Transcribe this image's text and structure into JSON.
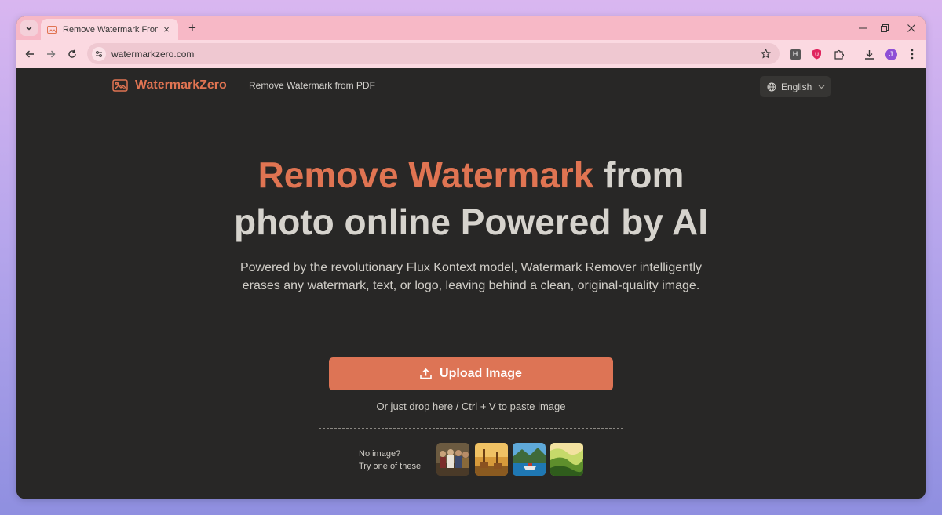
{
  "browser": {
    "tab_title": "Remove Watermark From Photo",
    "tab_close": "×",
    "new_tab": "+",
    "url": "watermarkzero.com",
    "ext_h_label": "H",
    "avatar_letter": "J"
  },
  "header": {
    "logo_text": "WatermarkZero",
    "nav_link": "Remove Watermark from PDF",
    "language": "English"
  },
  "hero": {
    "title_accent": "Remove Watermark",
    "title_rest_line1": " from",
    "title_line2": "photo online Powered by AI",
    "subtitle": "Powered by the revolutionary Flux Kontext model, Watermark Remover intelligently erases any watermark, text, or logo, leaving behind a clean, original-quality image.",
    "upload_label": "Upload Image",
    "drop_hint": "Or just drop here / Ctrl + V to paste image"
  },
  "samples": {
    "line1": "No image?",
    "line2": "Try one of these",
    "thumbnails": [
      "group-portrait-thumbnail",
      "giraffes-thumbnail",
      "lake-boat-thumbnail",
      "green-valley-thumbnail"
    ]
  },
  "colors": {
    "accent": "#e07452",
    "page_bg": "#282726",
    "tab_strip": "#f7b8c6"
  }
}
